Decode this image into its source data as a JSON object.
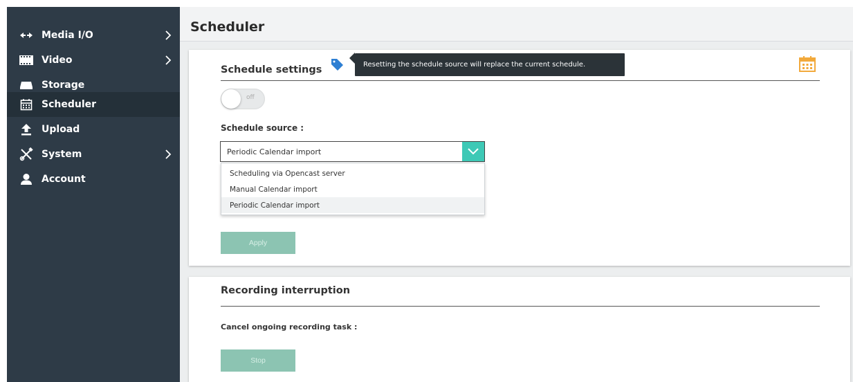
{
  "sidebar": {
    "items": [
      {
        "label": "Media I/O",
        "icon": "arrows-icon",
        "has_submenu": true
      },
      {
        "label": "Video",
        "icon": "film-icon",
        "has_submenu": true
      },
      {
        "label": "Storage",
        "icon": "storage-icon",
        "has_submenu": false
      },
      {
        "label": "Scheduler",
        "icon": "calendar-icon",
        "has_submenu": false,
        "active": true
      },
      {
        "label": "Upload",
        "icon": "upload-icon",
        "has_submenu": false
      },
      {
        "label": "System",
        "icon": "tools-icon",
        "has_submenu": true
      },
      {
        "label": "Account",
        "icon": "user-icon",
        "has_submenu": false
      }
    ]
  },
  "header": {
    "title": "Scheduler"
  },
  "schedule_settings": {
    "title": "Schedule settings",
    "tooltip": "Resetting the schedule source will replace the current schedule.",
    "toggle_state": "off",
    "source_label": "Schedule source :",
    "source_selected": "Periodic Calendar import",
    "source_options": [
      "Scheduling via Opencast server",
      "Manual Calendar import",
      "Periodic Calendar import"
    ],
    "apply_label": "Apply"
  },
  "recording_interruption": {
    "title": "Recording interruption",
    "cancel_label": "Cancel ongoing recording task :",
    "stop_label": "Stop"
  },
  "colors": {
    "sidebar_bg": "#2e3b47",
    "accent": "#3ec9b6",
    "button_disabled": "#8cc4b2",
    "calendar_icon": "#f2a93b",
    "info_icon": "#2d7fd3"
  }
}
